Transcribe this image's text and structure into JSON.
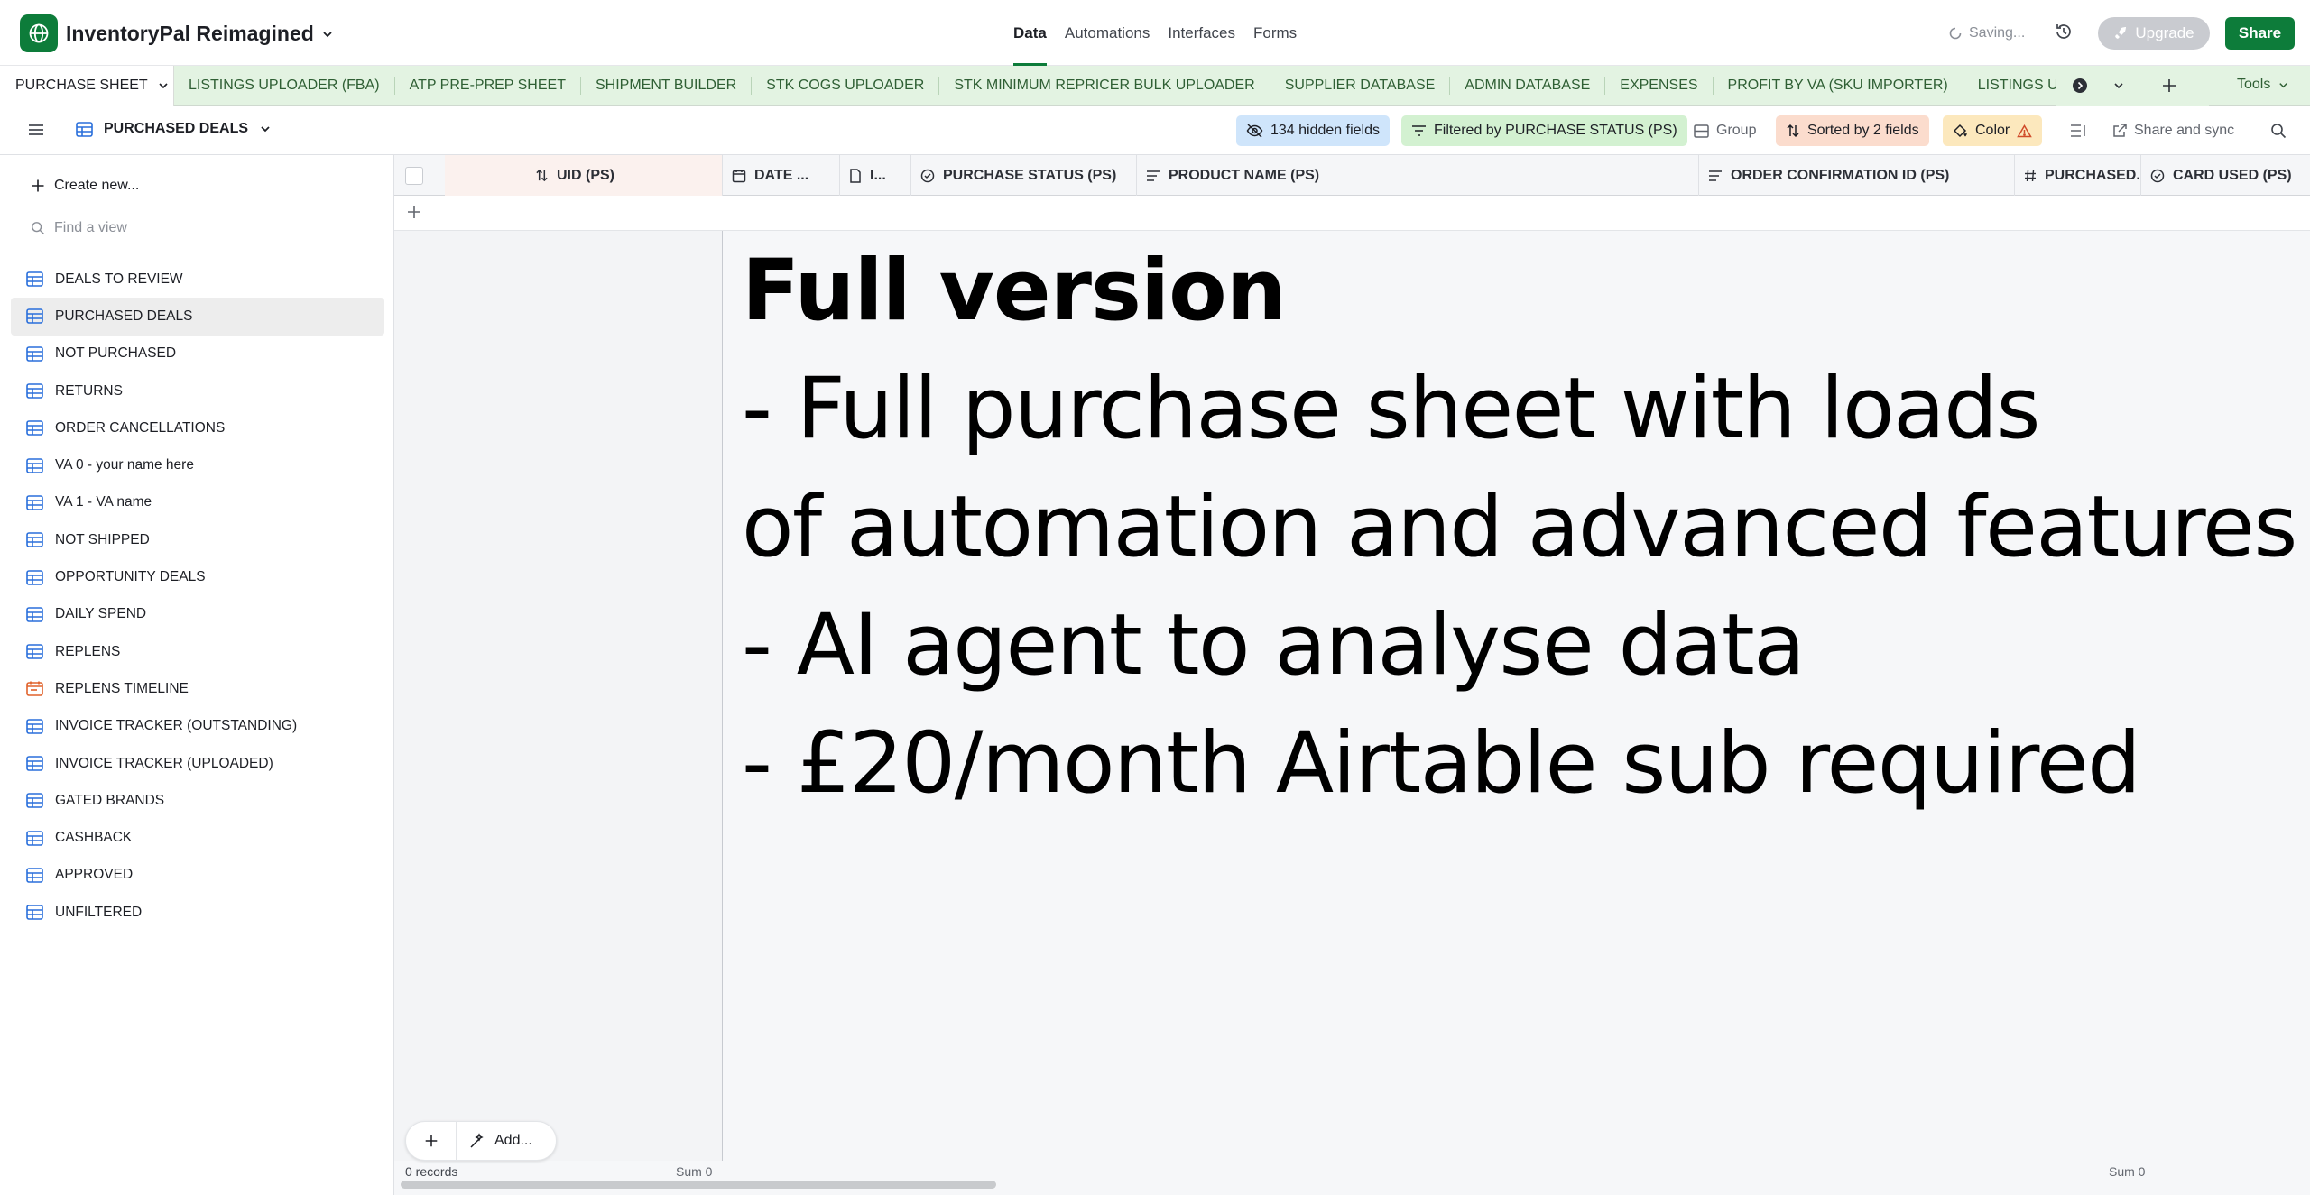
{
  "topbar": {
    "base_name": "InventoryPal Reimagined",
    "nav": [
      "Data",
      "Automations",
      "Interfaces",
      "Forms"
    ],
    "active_nav": "Data",
    "saving": "Saving...",
    "upgrade": "Upgrade",
    "share": "Share"
  },
  "tables": {
    "active": "PURCHASE SHEET",
    "others": [
      "LISTINGS UPLOADER (FBA)",
      "ATP PRE-PREP SHEET",
      "SHIPMENT BUILDER",
      "STK COGS UPLOADER",
      "STK MINIMUM REPRICER BULK UPLOADER",
      "SUPPLIER DATABASE",
      "ADMIN DATABASE",
      "EXPENSES",
      "PROFIT BY VA (SKU IMPORTER)",
      "LISTINGS UPLOADER (FBM)"
    ],
    "tools": "Tools"
  },
  "viewbar": {
    "view_name": "PURCHASED DEALS",
    "hidden_fields": "134 hidden fields",
    "filter": "Filtered by PURCHASE STATUS (PS)",
    "group": "Group",
    "sort": "Sorted by 2 fields",
    "color": "Color",
    "share_sync": "Share and sync"
  },
  "sidebar": {
    "create_new": "Create new...",
    "find_placeholder": "Find a view",
    "views": [
      {
        "label": "DEALS TO REVIEW",
        "icon": "grid-icon"
      },
      {
        "label": "PURCHASED DEALS",
        "icon": "grid-icon",
        "selected": true
      },
      {
        "label": "NOT PURCHASED",
        "icon": "grid-icon"
      },
      {
        "label": "RETURNS",
        "icon": "grid-icon"
      },
      {
        "label": "ORDER CANCELLATIONS",
        "icon": "grid-icon"
      },
      {
        "label": "VA 0 - your name here",
        "icon": "grid-icon"
      },
      {
        "label": "VA 1 - VA name",
        "icon": "grid-icon"
      },
      {
        "label": "NOT SHIPPED",
        "icon": "grid-icon"
      },
      {
        "label": "OPPORTUNITY DEALS",
        "icon": "grid-icon"
      },
      {
        "label": "DAILY SPEND",
        "icon": "grid-icon"
      },
      {
        "label": "REPLENS",
        "icon": "grid-icon"
      },
      {
        "label": "REPLENS TIMELINE",
        "icon": "timeline-icon"
      },
      {
        "label": "INVOICE TRACKER (OUTSTANDING)",
        "icon": "grid-icon"
      },
      {
        "label": "INVOICE TRACKER (UPLOADED)",
        "icon": "grid-icon"
      },
      {
        "label": "GATED BRANDS",
        "icon": "grid-icon"
      },
      {
        "label": "CASHBACK",
        "icon": "grid-icon"
      },
      {
        "label": "APPROVED",
        "icon": "grid-icon"
      },
      {
        "label": "UNFILTERED",
        "icon": "grid-icon"
      }
    ]
  },
  "grid": {
    "columns": [
      {
        "label": "UID (PS)",
        "icon": "sort-icon"
      },
      {
        "label": "DATE ...",
        "icon": "calendar-icon"
      },
      {
        "label": "I...",
        "icon": "doc-icon"
      },
      {
        "label": "PURCHASE STATUS (PS)",
        "icon": "status-icon"
      },
      {
        "label": "PRODUCT NAME (PS)",
        "icon": "text-icon"
      },
      {
        "label": "ORDER CONFIRMATION ID (PS)",
        "icon": "text-icon"
      },
      {
        "label": "PURCHASED...",
        "icon": "hash-icon"
      },
      {
        "label": "CARD USED (PS)",
        "icon": "status-icon"
      }
    ]
  },
  "overlay": {
    "title": "Full version",
    "lines": [
      "- Full purchase sheet with loads",
      "of automation and advanced features",
      "- AI agent to analyse data",
      "- £20/month Airtable sub required"
    ]
  },
  "footer": {
    "add_label": "Add...",
    "records": "0 records",
    "sum_left": "Sum 0",
    "sum_right": "Sum 0"
  },
  "colors": {
    "brand": "#0d7c3a",
    "tab_bar": "#e3f3e2",
    "hidden_fields": "#cfe5fb",
    "filter": "#d3f1d1",
    "sort": "#fbdccd",
    "color": "#fce8bd"
  }
}
